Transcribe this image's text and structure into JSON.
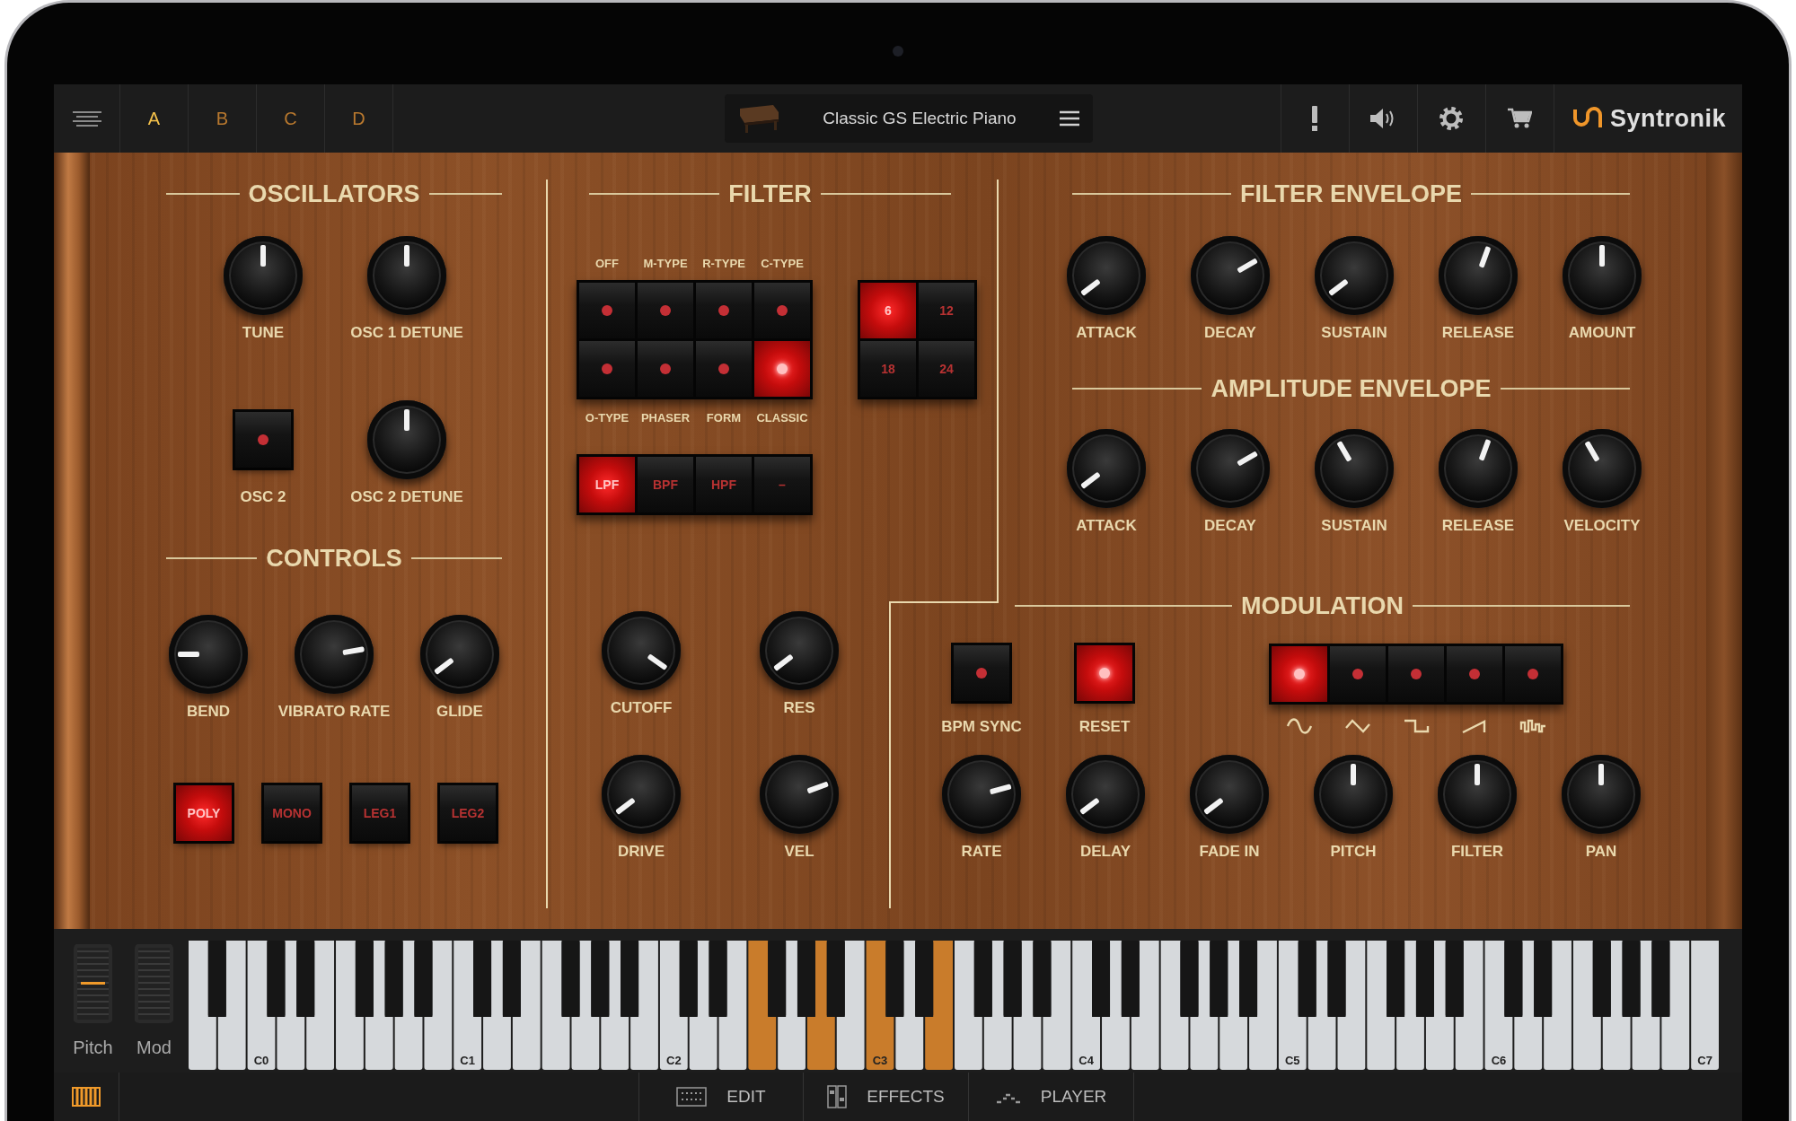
{
  "top_bar": {
    "tabs": [
      {
        "label": "A",
        "selected": true
      },
      {
        "label": "B",
        "selected": false
      },
      {
        "label": "C",
        "selected": false
      },
      {
        "label": "D",
        "selected": false
      }
    ],
    "preset": {
      "name": "Classic GS Electric Piano"
    },
    "logo": "Syntronik"
  },
  "oscillators": {
    "title": "OSCILLATORS",
    "controls": [
      {
        "kind": "knob",
        "label": "TUNE"
      },
      {
        "kind": "knob",
        "label": "OSC 1 DETUNE"
      },
      {
        "kind": "button",
        "label": "OSC 2",
        "on": false
      },
      {
        "kind": "knob",
        "label": "OSC 2 DETUNE"
      }
    ]
  },
  "controls": {
    "title": "CONTROLS",
    "knobs": [
      {
        "label": "BEND"
      },
      {
        "label": "VIBRATO RATE"
      },
      {
        "label": "GLIDE"
      }
    ],
    "modes": [
      {
        "label": "POLY",
        "selected": true
      },
      {
        "label": "MONO",
        "selected": false
      },
      {
        "label": "LEG1",
        "selected": false
      },
      {
        "label": "LEG2",
        "selected": false
      }
    ]
  },
  "filter": {
    "title": "FILTER",
    "types": [
      {
        "label": "OFF",
        "selected": false
      },
      {
        "label": "M-TYPE",
        "selected": false
      },
      {
        "label": "R-TYPE",
        "selected": false
      },
      {
        "label": "C-TYPE",
        "selected": false
      },
      {
        "label": "O-TYPE",
        "selected": false
      },
      {
        "label": "PHASER",
        "selected": false
      },
      {
        "label": "FORM",
        "selected": false
      },
      {
        "label": "CLASSIC",
        "selected": true
      }
    ],
    "slopes": [
      {
        "label": "6",
        "selected": true
      },
      {
        "label": "12",
        "selected": false
      },
      {
        "label": "18",
        "selected": false
      },
      {
        "label": "24",
        "selected": false
      }
    ],
    "modes": [
      {
        "label": "LPF",
        "selected": true
      },
      {
        "label": "BPF",
        "selected": false
      },
      {
        "label": "HPF",
        "selected": false
      },
      {
        "label": "–",
        "selected": false
      }
    ],
    "knobs": [
      {
        "label": "CUTOFF"
      },
      {
        "label": "RES"
      },
      {
        "label": "DRIVE"
      },
      {
        "label": "VEL"
      }
    ]
  },
  "filter_envelope": {
    "title": "FILTER ENVELOPE",
    "knobs": [
      {
        "label": "ATTACK"
      },
      {
        "label": "DECAY"
      },
      {
        "label": "SUSTAIN"
      },
      {
        "label": "RELEASE"
      },
      {
        "label": "AMOUNT"
      }
    ]
  },
  "amplitude_envelope": {
    "title": "AMPLITUDE ENVELOPE",
    "knobs": [
      {
        "label": "ATTACK"
      },
      {
        "label": "DECAY"
      },
      {
        "label": "SUSTAIN"
      },
      {
        "label": "RELEASE"
      },
      {
        "label": "VELOCITY"
      }
    ]
  },
  "modulation": {
    "title": "MODULATION",
    "buttons": [
      {
        "label": "BPM SYNC",
        "on": false
      },
      {
        "label": "RESET",
        "on": true
      }
    ],
    "waves": [
      {
        "kind": "sine",
        "selected": true
      },
      {
        "kind": "triangle",
        "selected": false
      },
      {
        "kind": "square",
        "selected": false
      },
      {
        "kind": "saw",
        "selected": false
      },
      {
        "kind": "random",
        "selected": false
      }
    ],
    "knobs": [
      {
        "label": "RATE"
      },
      {
        "label": "DELAY"
      },
      {
        "label": "FADE IN"
      },
      {
        "label": "PITCH"
      },
      {
        "label": "FILTER"
      },
      {
        "label": "PAN"
      }
    ]
  },
  "keyboard": {
    "wheels": [
      {
        "label": "Pitch",
        "indicator": true
      },
      {
        "label": "Mod",
        "indicator": false
      }
    ],
    "white_keys": [
      {
        "pressed": false
      },
      {
        "pressed": false
      },
      {
        "label": "C0",
        "pressed": false
      },
      {
        "pressed": false
      },
      {
        "pressed": false
      },
      {
        "pressed": false
      },
      {
        "pressed": false
      },
      {
        "pressed": false
      },
      {
        "pressed": false
      },
      {
        "label": "C1",
        "pressed": false
      },
      {
        "pressed": false
      },
      {
        "pressed": false
      },
      {
        "pressed": false
      },
      {
        "pressed": false
      },
      {
        "pressed": false
      },
      {
        "pressed": false
      },
      {
        "label": "C2",
        "pressed": false
      },
      {
        "pressed": false
      },
      {
        "pressed": false
      },
      {
        "pressed": true
      },
      {
        "pressed": false
      },
      {
        "pressed": true
      },
      {
        "pressed": false
      },
      {
        "label": "C3",
        "pressed": true
      },
      {
        "pressed": false
      },
      {
        "pressed": true
      },
      {
        "pressed": false
      },
      {
        "pressed": false
      },
      {
        "pressed": false
      },
      {
        "pressed": false
      },
      {
        "label": "C4",
        "pressed": false
      },
      {
        "pressed": false
      },
      {
        "pressed": false
      },
      {
        "pressed": false
      },
      {
        "pressed": false
      },
      {
        "pressed": false
      },
      {
        "pressed": false
      },
      {
        "label": "C5",
        "pressed": false
      },
      {
        "pressed": false
      },
      {
        "pressed": false
      },
      {
        "pressed": false
      },
      {
        "pressed": false
      },
      {
        "pressed": false
      },
      {
        "pressed": false
      },
      {
        "label": "C6",
        "pressed": false
      },
      {
        "pressed": false
      },
      {
        "pressed": false
      },
      {
        "pressed": false
      },
      {
        "pressed": false
      },
      {
        "pressed": false
      },
      {
        "pressed": false
      },
      {
        "label": "C7",
        "pressed": false
      }
    ]
  },
  "bottom_bar": {
    "tabs": [
      {
        "kind": "keyboard",
        "selected": true
      },
      {
        "kind": "edit",
        "label": "EDIT",
        "selected": false
      },
      {
        "kind": "effects",
        "label": "EFFECTS",
        "selected": false
      },
      {
        "kind": "player",
        "label": "PLAYER",
        "selected": false
      }
    ]
  }
}
